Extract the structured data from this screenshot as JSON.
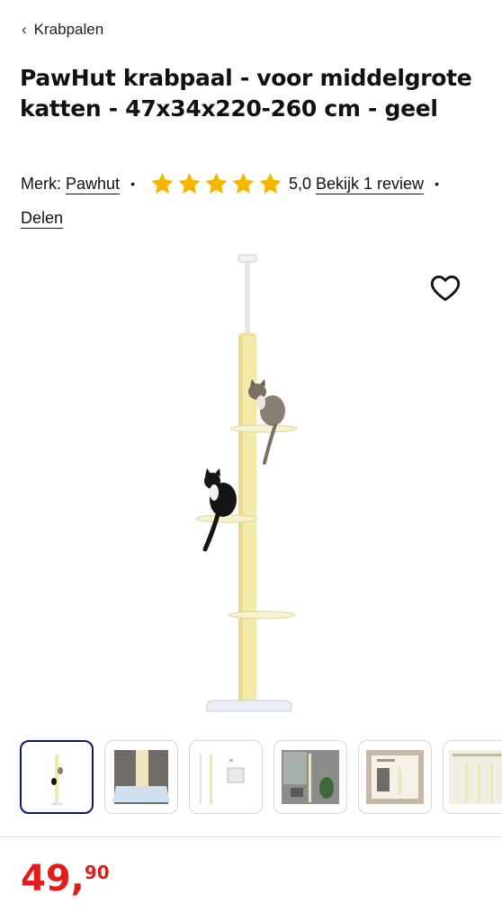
{
  "nav": {
    "back_label": "Krabpalen"
  },
  "product": {
    "title": "PawHut krabpaal - voor middelgrote katten - 47x34x220-260 cm - geel",
    "brand_prefix": "Merk:",
    "brand": "Pawhut",
    "rating": 5,
    "rating_text": "5,0",
    "review_link": "Bekijk 1 review",
    "share_label": "Delen",
    "price_int": "49",
    "price_dec": "90"
  },
  "colors": {
    "star": "#f6b500",
    "price": "#e21b1b",
    "active_thumb": "#0c1a6b",
    "post": "#f3eaa9"
  },
  "thumbnails": [
    {
      "name": "thumb-1",
      "active": true
    },
    {
      "name": "thumb-2",
      "active": false
    },
    {
      "name": "thumb-3",
      "active": false
    },
    {
      "name": "thumb-4",
      "active": false
    },
    {
      "name": "thumb-5",
      "active": false
    },
    {
      "name": "thumb-6",
      "active": false
    }
  ]
}
